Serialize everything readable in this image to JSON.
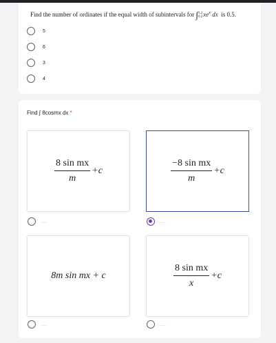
{
  "question1": {
    "text_before": "Find the number of ordinates if the equal width of subintervals for",
    "integral_symbol": "∫",
    "upper_limit": "1.2",
    "lower_limit": "0.2",
    "integrand": "xe",
    "integrand_exp": "x",
    "differential": "dx",
    "text_after": "is 0.5.",
    "options": [
      {
        "label": "5"
      },
      {
        "label": "6"
      },
      {
        "label": "3"
      },
      {
        "label": "4"
      }
    ]
  },
  "question2": {
    "title": "Find ∫ 8cosmx dx",
    "required_mark": "*",
    "options": [
      {
        "numerator": "8 sin mx",
        "denominator": "m",
        "tail": "+c",
        "label": "...",
        "selected": false
      },
      {
        "numerator": "−8 sin mx",
        "denominator": "m",
        "tail": "+c",
        "label": "...",
        "selected": true
      },
      {
        "expression": "8m sin mx + c",
        "label": "...",
        "selected": false
      },
      {
        "numerator": "8 sin mx",
        "denominator": "x",
        "tail": "+c",
        "label": "...",
        "selected": false
      }
    ]
  },
  "colors": {
    "accent": "#673ab7",
    "selected_border": "#3c4aa5",
    "required": "#d93025",
    "background": "#f1f3f4"
  }
}
